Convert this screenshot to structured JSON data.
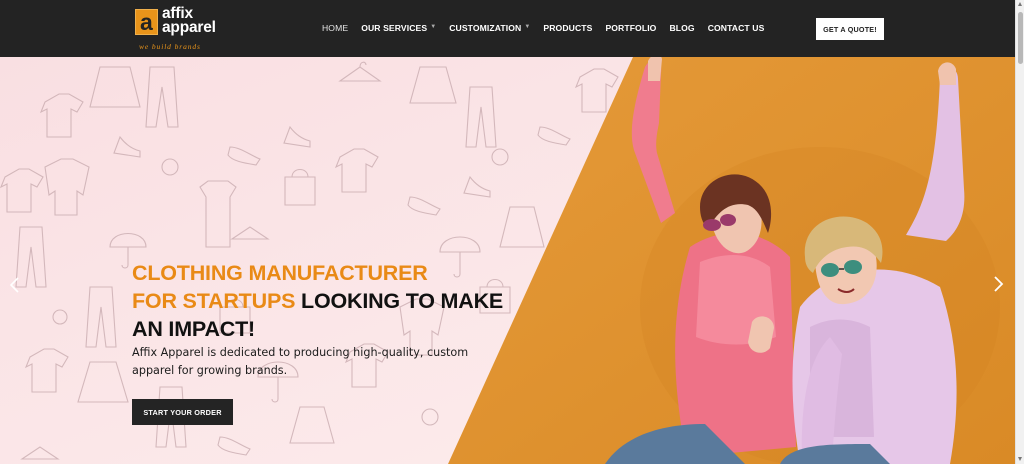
{
  "brand": {
    "mark_letter": "a",
    "name_line1": "affix",
    "name_line2": "apparel",
    "tagline": "we build brands"
  },
  "nav": {
    "items": [
      {
        "label": "HOME",
        "active": true,
        "dropdown": false
      },
      {
        "label": "OUR SERVICES",
        "active": false,
        "dropdown": true
      },
      {
        "label": "CUSTOMIZATION",
        "active": false,
        "dropdown": true
      },
      {
        "label": "PRODUCTS",
        "active": false,
        "dropdown": false
      },
      {
        "label": "PORTFOLIO",
        "active": false,
        "dropdown": false
      },
      {
        "label": "BLOG",
        "active": false,
        "dropdown": false
      },
      {
        "label": "CONTACT US",
        "active": false,
        "dropdown": false
      }
    ],
    "quote_button": "GET A QUOTE!"
  },
  "hero": {
    "headline_line1": "CLOTHING MANUFACTURER",
    "headline_line2_orange": "FOR STARTUPS",
    "headline_line2_rest": " LOOKING TO MAKE",
    "headline_line3": "AN IMPACT!",
    "subtitle": "Affix Apparel is dedicated to producing high-quality, custom apparel for growing brands.",
    "cta_label": "START YOUR ORDER"
  },
  "icons": {
    "prev": "chevron-left-icon",
    "next": "chevron-right-icon",
    "caret": "chevron-down-icon"
  },
  "colors": {
    "header_bg": "#232323",
    "accent_orange": "#e98a16",
    "hero_pink": "#fbe6e7",
    "photo_orange": "#e49836",
    "cta_bg": "#242424"
  }
}
